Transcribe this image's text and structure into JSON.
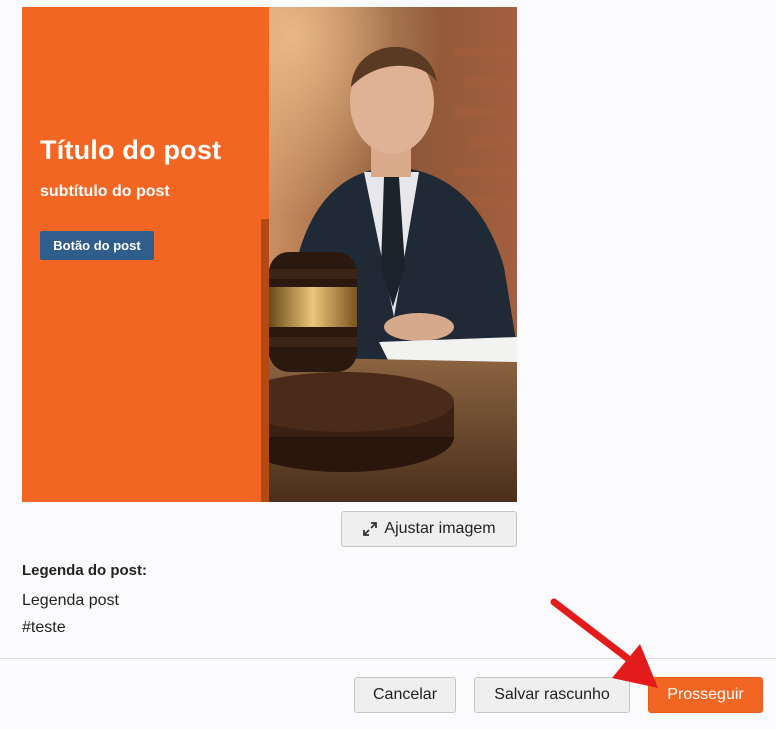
{
  "post": {
    "title": "Título do post",
    "subtitle": "subtítulo do post",
    "button_label": "Botão do post",
    "accent_color": "#f26522",
    "button_color": "#2f5e8c",
    "image": "lawyer-with-gavel-photo"
  },
  "adjust_image": {
    "icon": "expand-icon",
    "label": "Ajustar imagem"
  },
  "caption": {
    "heading": "Legenda do post:",
    "lines": [
      "Legenda post",
      "#teste"
    ]
  },
  "footer": {
    "cancel_label": "Cancelar",
    "draft_label": "Salvar rascunho",
    "continue_label": "Prosseguir",
    "continue_color": "#f26522"
  },
  "annotation": {
    "icon": "red-arrow-icon",
    "color": "#e31b1b"
  }
}
